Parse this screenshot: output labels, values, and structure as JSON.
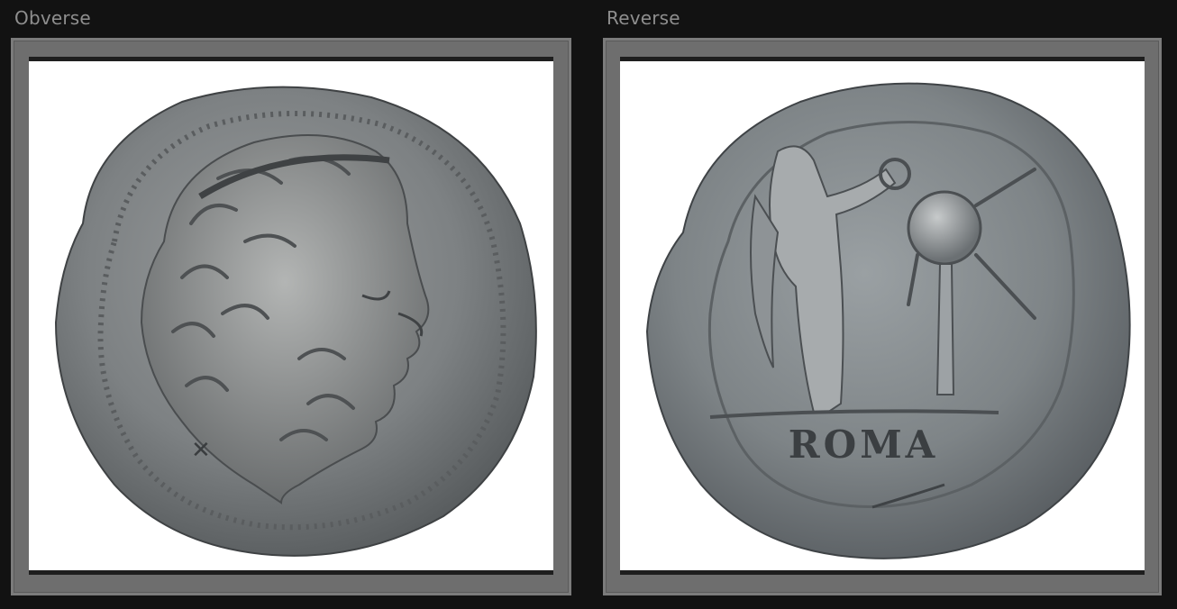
{
  "viewer": {
    "obverse": {
      "label": "Obverse"
    },
    "reverse": {
      "label": "Reverse",
      "legend": "ROMA"
    }
  },
  "colors": {
    "background": "#121212",
    "label": "#8e8e8e",
    "frame": "#6e6e6e",
    "coin_silver": "#8a8d8f"
  },
  "icons": {
    "obverse_image": "coin-obverse-image",
    "reverse_image": "coin-reverse-image"
  }
}
